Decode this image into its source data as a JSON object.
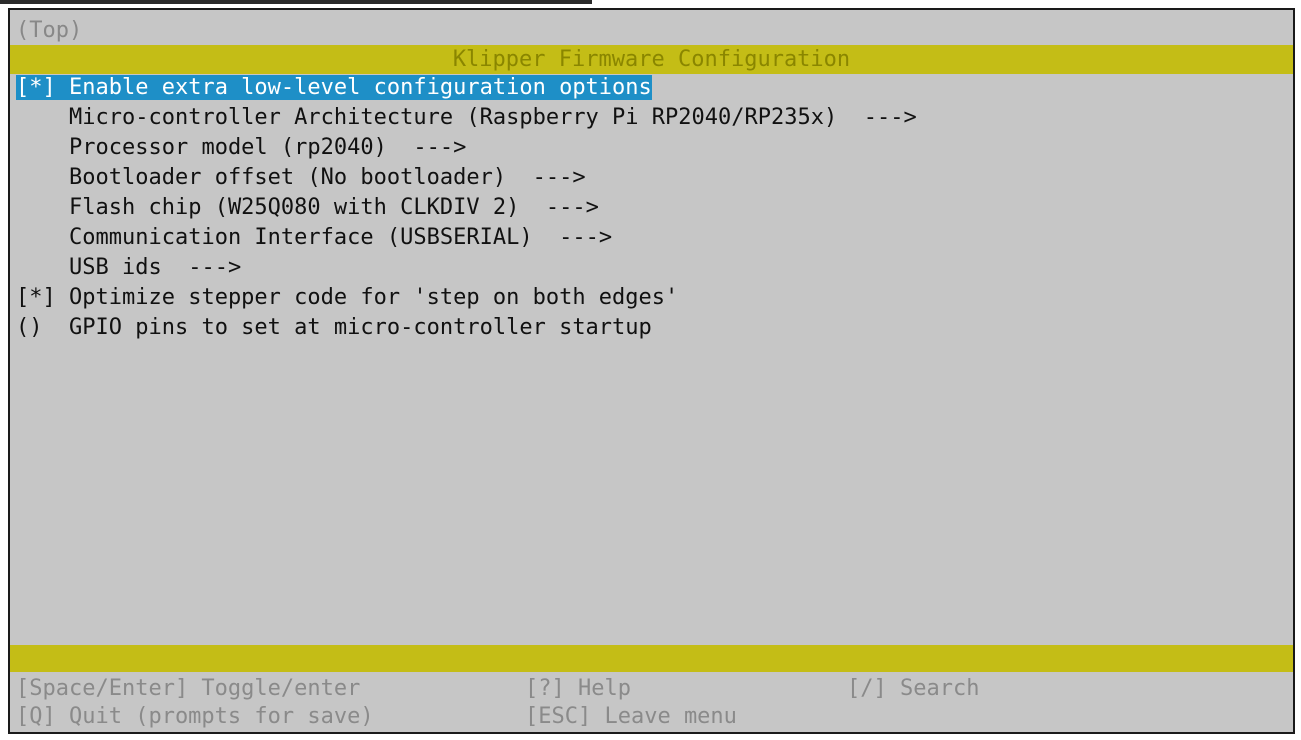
{
  "breadcrumb": "(Top)",
  "title": "Klipper Firmware Configuration",
  "items": [
    {
      "prefix": "[*]",
      "label": "Enable extra low-level configuration options",
      "suffix": ""
    },
    {
      "prefix": "   ",
      "label": "Micro-controller Architecture (Raspberry Pi RP2040/RP235x)",
      "suffix": "--->"
    },
    {
      "prefix": "   ",
      "label": "Processor model (rp2040)",
      "suffix": "--->"
    },
    {
      "prefix": "   ",
      "label": "Bootloader offset (No bootloader)",
      "suffix": "--->"
    },
    {
      "prefix": "   ",
      "label": "Flash chip (W25Q080 with CLKDIV 2)",
      "suffix": "--->"
    },
    {
      "prefix": "   ",
      "label": "Communication Interface (USBSERIAL)",
      "suffix": "--->"
    },
    {
      "prefix": "   ",
      "label": "USB ids",
      "suffix": "--->"
    },
    {
      "prefix": "[*]",
      "label": "Optimize stepper code for 'step on both edges'",
      "suffix": ""
    },
    {
      "prefix": "() ",
      "label": "GPIO pins to set at micro-controller startup",
      "suffix": ""
    }
  ],
  "help": {
    "toggle": "[Space/Enter] Toggle/enter",
    "help": "[?] Help",
    "search": "[/] Search",
    "quit": "[Q] Quit (prompts for save)",
    "leave": "[ESC] Leave menu"
  },
  "colors": {
    "terminal_bg": "#c6c6c6",
    "bar_yellow": "#c4bd16",
    "selection_blue": "#1e8fc7"
  }
}
